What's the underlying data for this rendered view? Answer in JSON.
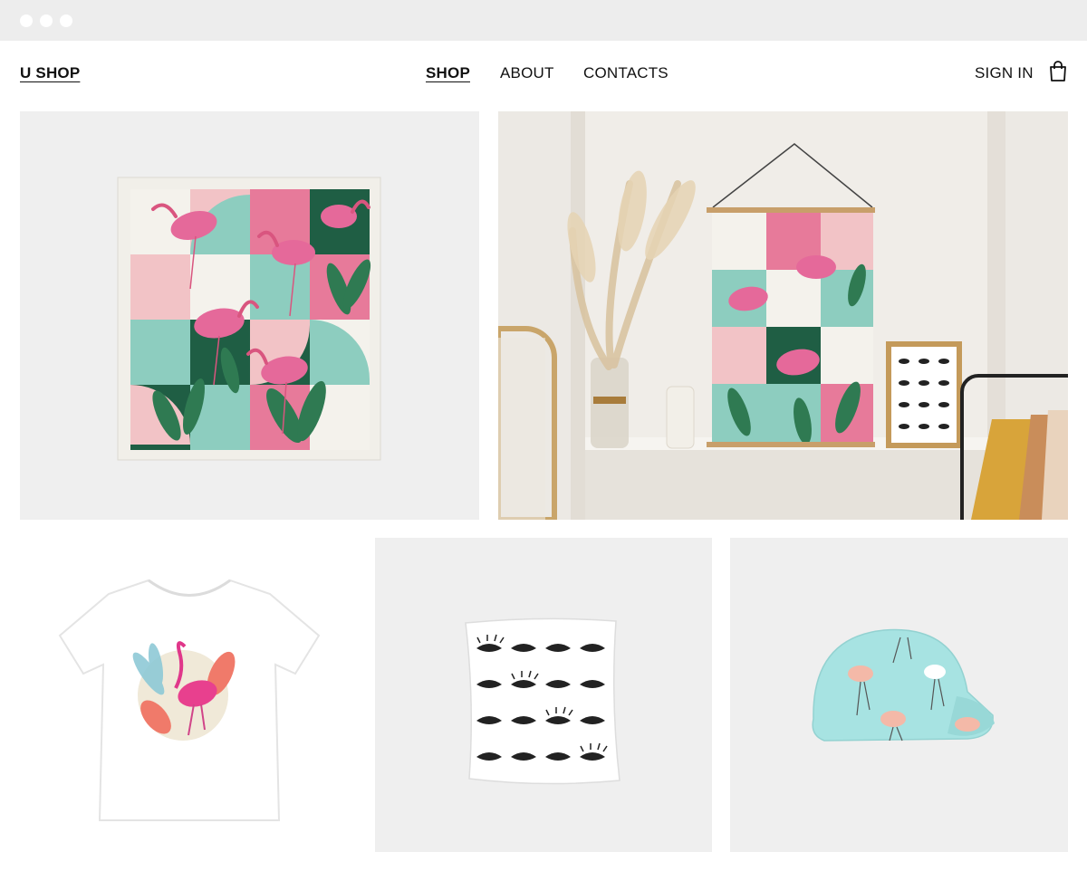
{
  "window": {
    "controls": [
      "close",
      "minimize",
      "maximize"
    ]
  },
  "header": {
    "logo": "U SHOP",
    "nav": [
      {
        "label": "SHOP",
        "active": true
      },
      {
        "label": "ABOUT",
        "active": false
      },
      {
        "label": "CONTACTS",
        "active": false
      }
    ],
    "sign_in": "SIGN IN",
    "cart_icon": "shopping-bag-icon"
  },
  "products": [
    {
      "name": "flamingo-scarf"
    },
    {
      "name": "flamingo-poster-room"
    },
    {
      "name": "flamingo-tshirt"
    },
    {
      "name": "eyes-pillow"
    },
    {
      "name": "flamingo-cap"
    }
  ],
  "colors": {
    "pink": "#e77a9a",
    "mint": "#8dcdbf",
    "darkgreen": "#1f5e44",
    "teal": "#5ba893",
    "cream": "#f3efe6",
    "chrome": "#ededed"
  }
}
